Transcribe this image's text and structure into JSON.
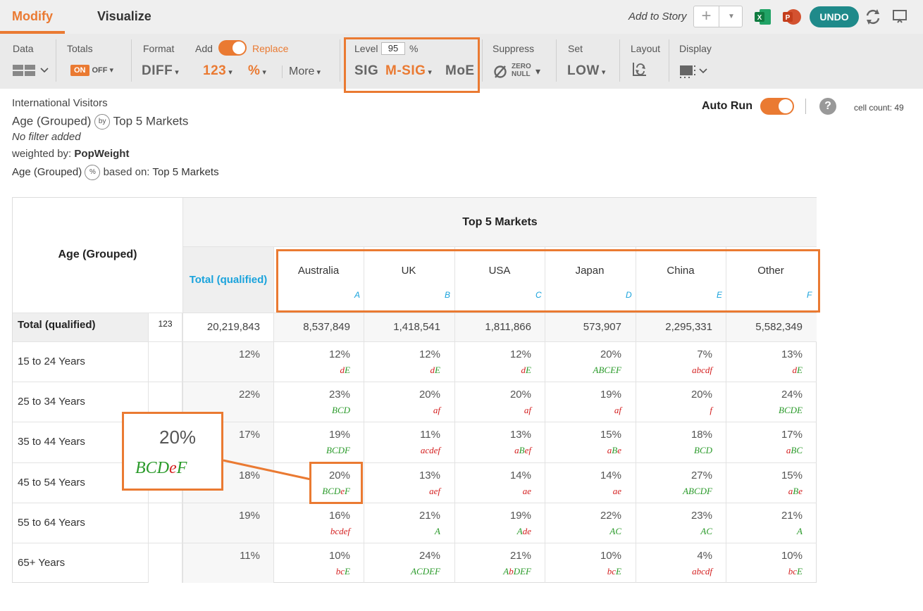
{
  "header": {
    "tab_modify": "Modify",
    "tab_visualize": "Visualize",
    "add_to_story": "Add to Story",
    "undo_label": "UNDO"
  },
  "toolbar": {
    "data_label": "Data",
    "totals_label": "Totals",
    "totals_on": "ON",
    "totals_off": "OFF",
    "format_label": "Format",
    "format_value": "DIFF",
    "add_label": "Add",
    "replace_label": "Replace",
    "number_value": "123",
    "percent_value": "%",
    "more_label": "More",
    "level_label": "Level",
    "level_value": "95",
    "level_unit": "%",
    "sig_label": "SIG",
    "msig_label": "M-SIG",
    "moe_label": "MoE",
    "suppress_label": "Suppress",
    "zero_label": "ZERO",
    "null_label": "NULL",
    "set_label": "Set",
    "set_value": "LOW",
    "layout_label": "Layout",
    "display_label": "Display"
  },
  "info": {
    "dataset": "International Visitors",
    "row_var": "Age (Grouped)",
    "by_badge": "by",
    "col_var": "Top 5 Markets",
    "filter": "No filter added",
    "weighted_prefix": "weighted by:",
    "weight": "PopWeight",
    "pct_row_var": "Age (Grouped)",
    "pct_badge": "%",
    "based_on_prefix": "based on:",
    "based_on": "Top 5 Markets",
    "auto_run": "Auto Run",
    "help": "?",
    "cell_count": "cell count: 49"
  },
  "table": {
    "row_header": "Age (Grouped)",
    "banner": "Top 5 Markets",
    "total_col": "Total (qualified)",
    "columns": [
      {
        "name": "Australia",
        "letter": "A"
      },
      {
        "name": "UK",
        "letter": "B"
      },
      {
        "name": "USA",
        "letter": "C"
      },
      {
        "name": "Japan",
        "letter": "D"
      },
      {
        "name": "China",
        "letter": "E"
      },
      {
        "name": "Other",
        "letter": "F"
      }
    ],
    "total_row": {
      "label": "Total (qualified)",
      "badge": "123",
      "total": "20,219,843",
      "values": [
        "8,537,849",
        "1,418,541",
        "1,811,866",
        "573,907",
        "2,295,331",
        "5,582,349"
      ]
    },
    "rows": [
      {
        "label": "15 to 24 Years",
        "total": "12%",
        "cells": [
          [
            "12%",
            "dE"
          ],
          [
            "12%",
            "dE"
          ],
          [
            "12%",
            "dE"
          ],
          [
            "20%",
            "ABCEF"
          ],
          [
            "7%",
            "abcdf"
          ],
          [
            "13%",
            "dE"
          ]
        ]
      },
      {
        "label": "25 to 34 Years",
        "total": "22%",
        "cells": [
          [
            "23%",
            "BCD"
          ],
          [
            "20%",
            "af"
          ],
          [
            "20%",
            "af"
          ],
          [
            "19%",
            "af"
          ],
          [
            "20%",
            "f"
          ],
          [
            "24%",
            "BCDE"
          ]
        ]
      },
      {
        "label": "35 to 44 Years",
        "total": "17%",
        "cells": [
          [
            "19%",
            "BCDF"
          ],
          [
            "11%",
            "acdef"
          ],
          [
            "13%",
            "aBef"
          ],
          [
            "15%",
            "aBe"
          ],
          [
            "18%",
            "BCD"
          ],
          [
            "17%",
            "aBC"
          ]
        ]
      },
      {
        "label": "45 to 54 Years",
        "total": "18%",
        "cells": [
          [
            "20%",
            "BCDeF"
          ],
          [
            "13%",
            "aef"
          ],
          [
            "14%",
            "ae"
          ],
          [
            "14%",
            "ae"
          ],
          [
            "27%",
            "ABCDF"
          ],
          [
            "15%",
            "aBe"
          ]
        ]
      },
      {
        "label": "55 to 64 Years",
        "total": "19%",
        "cells": [
          [
            "16%",
            "bcdef"
          ],
          [
            "21%",
            "A"
          ],
          [
            "19%",
            "Ade"
          ],
          [
            "22%",
            "AC"
          ],
          [
            "23%",
            "AC"
          ],
          [
            "21%",
            "A"
          ]
        ]
      },
      {
        "label": "65+ Years",
        "total": "11%",
        "cells": [
          [
            "10%",
            "bcE"
          ],
          [
            "24%",
            "ACDEF"
          ],
          [
            "21%",
            "AbDEF"
          ],
          [
            "10%",
            "bcE"
          ],
          [
            "4%",
            "abcdf"
          ],
          [
            "10%",
            "bcE"
          ]
        ]
      }
    ]
  },
  "callout": {
    "pct": "20%",
    "sig": "BCDeF"
  },
  "colors": {
    "accent": "#ea7a32",
    "teal": "#1f8a8a",
    "green": "#2a9a2a",
    "red": "#d42020",
    "blue": "#1aa3dc"
  }
}
